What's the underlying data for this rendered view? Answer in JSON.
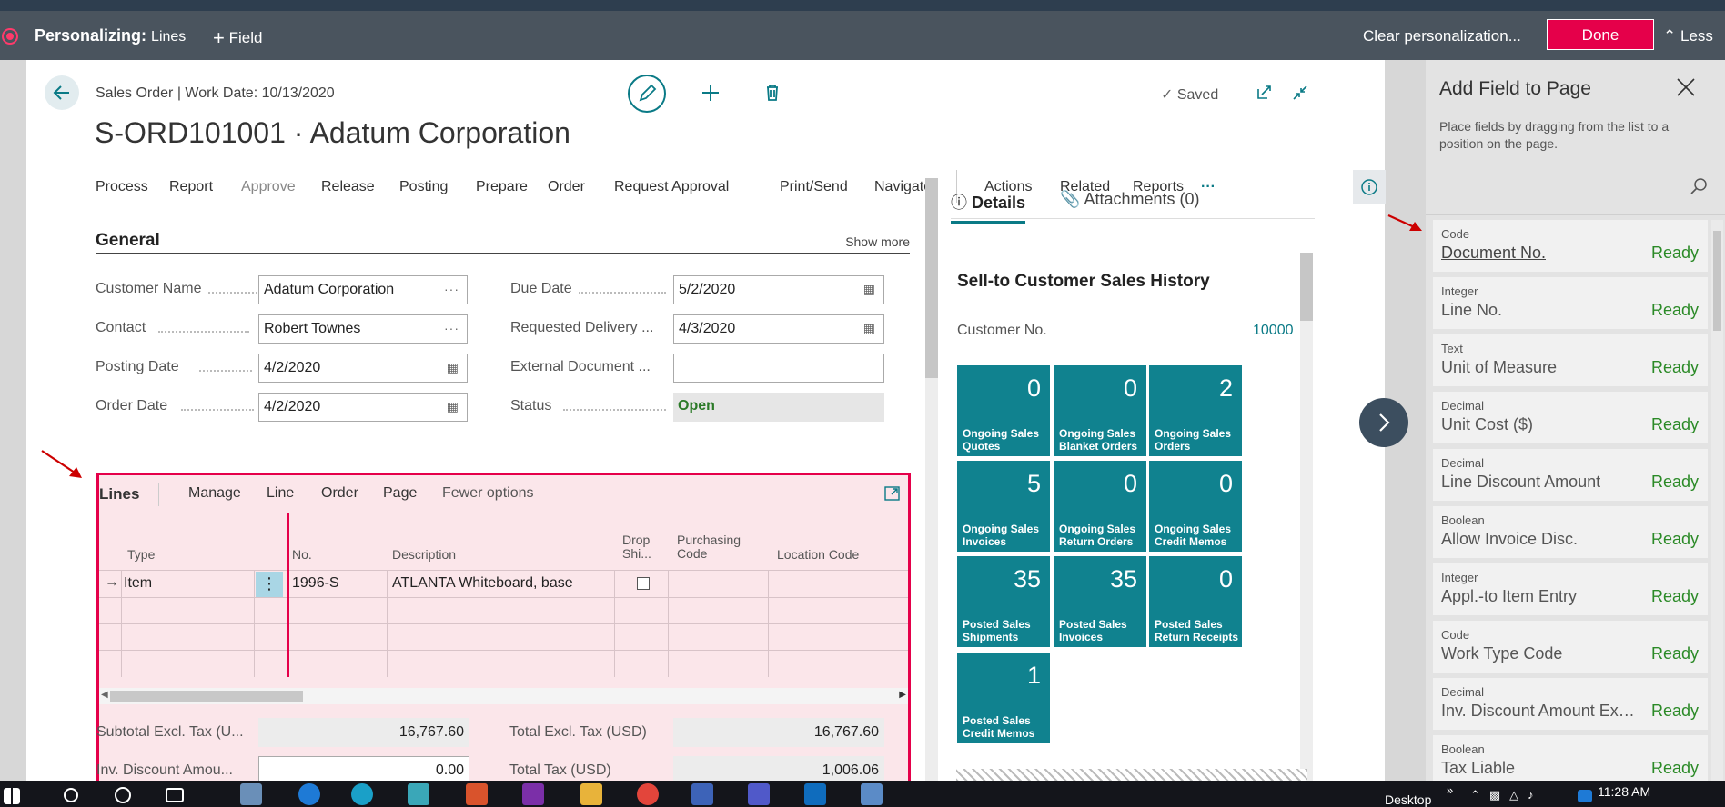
{
  "personalize": {
    "mode_label": "Personalizing:",
    "target": "Lines",
    "add_field": "Field",
    "clear": "Clear personalization...",
    "done": "Done",
    "less": "Less"
  },
  "page": {
    "breadcrumb": "Sales Order | Work Date: 10/13/2020",
    "title": "S-ORD101001 · Adatum Corporation",
    "saved": "Saved"
  },
  "actions": [
    "Process",
    "Report",
    "Approve",
    "Release",
    "Posting",
    "Prepare",
    "Order",
    "Request Approval",
    "Print/Send",
    "Navigate",
    "Actions",
    "Related",
    "Reports"
  ],
  "general": {
    "title": "General",
    "show_more": "Show more",
    "fields_left": [
      {
        "label": "Customer Name",
        "value": "Adatum Corporation",
        "trail": "···"
      },
      {
        "label": "Contact",
        "value": "Robert Townes",
        "trail": "···"
      },
      {
        "label": "Posting Date",
        "value": "4/2/2020",
        "trail": "cal"
      },
      {
        "label": "Order Date",
        "value": "4/2/2020",
        "trail": "cal"
      }
    ],
    "fields_right": [
      {
        "label": "Due Date",
        "value": "5/2/2020",
        "trail": "cal"
      },
      {
        "label": "Requested Delivery ...",
        "value": "4/3/2020",
        "trail": "cal"
      },
      {
        "label": "External Document ...",
        "value": "",
        "trail": ""
      },
      {
        "label": "Status",
        "value": "Open",
        "trail": ""
      }
    ]
  },
  "lines": {
    "title": "Lines",
    "menu": [
      "Manage",
      "Line",
      "Order",
      "Page",
      "Fewer options"
    ],
    "columns": [
      "Type",
      "No.",
      "Description",
      "Drop Shi...",
      "Purchasing Code",
      "Location Code"
    ],
    "rows": [
      {
        "type": "Item",
        "no": "1996-S",
        "description": "ATLANTA Whiteboard, base"
      }
    ],
    "totals": {
      "subtotal_label": "Subtotal Excl. Tax (U...",
      "subtotal_value": "16,767.60",
      "total_excl_label": "Total Excl. Tax (USD)",
      "total_excl_value": "16,767.60",
      "inv_disc_label": "Inv. Discount Amou...",
      "inv_disc_value": "0.00",
      "total_tax_label": "Total Tax (USD)",
      "total_tax_value": "1,006.06"
    }
  },
  "factbox": {
    "tab_details": "Details",
    "tab_attachments": "Attachments (0)",
    "history_title": "Sell-to Customer Sales History",
    "customer_no_label": "Customer No.",
    "customer_no_value": "10000",
    "tiles": [
      {
        "value": "0",
        "label": "Ongoing Sales Quotes"
      },
      {
        "value": "0",
        "label": "Ongoing Sales Blanket Orders"
      },
      {
        "value": "2",
        "label": "Ongoing Sales Orders"
      },
      {
        "value": "5",
        "label": "Ongoing Sales Invoices"
      },
      {
        "value": "0",
        "label": "Ongoing Sales Return Orders"
      },
      {
        "value": "0",
        "label": "Ongoing Sales Credit Memos"
      },
      {
        "value": "35",
        "label": "Posted Sales Shipments"
      },
      {
        "value": "35",
        "label": "Posted Sales Invoices"
      },
      {
        "value": "0",
        "label": "Posted Sales Return Receipts"
      },
      {
        "value": "1",
        "label": "Posted Sales Credit Memos"
      }
    ]
  },
  "panel": {
    "title": "Add Field to Page",
    "description": "Place fields by dragging from the list to a position on the page.",
    "fields": [
      {
        "type": "Code",
        "name": "Document No.",
        "status": "Ready"
      },
      {
        "type": "Integer",
        "name": "Line No.",
        "status": "Ready"
      },
      {
        "type": "Text",
        "name": "Unit of Measure",
        "status": "Ready"
      },
      {
        "type": "Decimal",
        "name": "Unit Cost ($)",
        "status": "Ready"
      },
      {
        "type": "Decimal",
        "name": "Line Discount Amount",
        "status": "Ready"
      },
      {
        "type": "Boolean",
        "name": "Allow Invoice Disc.",
        "status": "Ready"
      },
      {
        "type": "Integer",
        "name": "Appl.-to Item Entry",
        "status": "Ready"
      },
      {
        "type": "Code",
        "name": "Work Type Code",
        "status": "Ready"
      },
      {
        "type": "Decimal",
        "name": "Inv. Discount Amount Excl...",
        "status": "Ready"
      },
      {
        "type": "Boolean",
        "name": "Tax Liable",
        "status": "Ready"
      }
    ]
  },
  "taskbar": {
    "desktop": "Desktop",
    "time": "11:28 AM"
  },
  "colors": {
    "accent": "#0a7a86",
    "done": "#e5004a",
    "tile": "#10828f",
    "ready": "#2b8a27"
  }
}
